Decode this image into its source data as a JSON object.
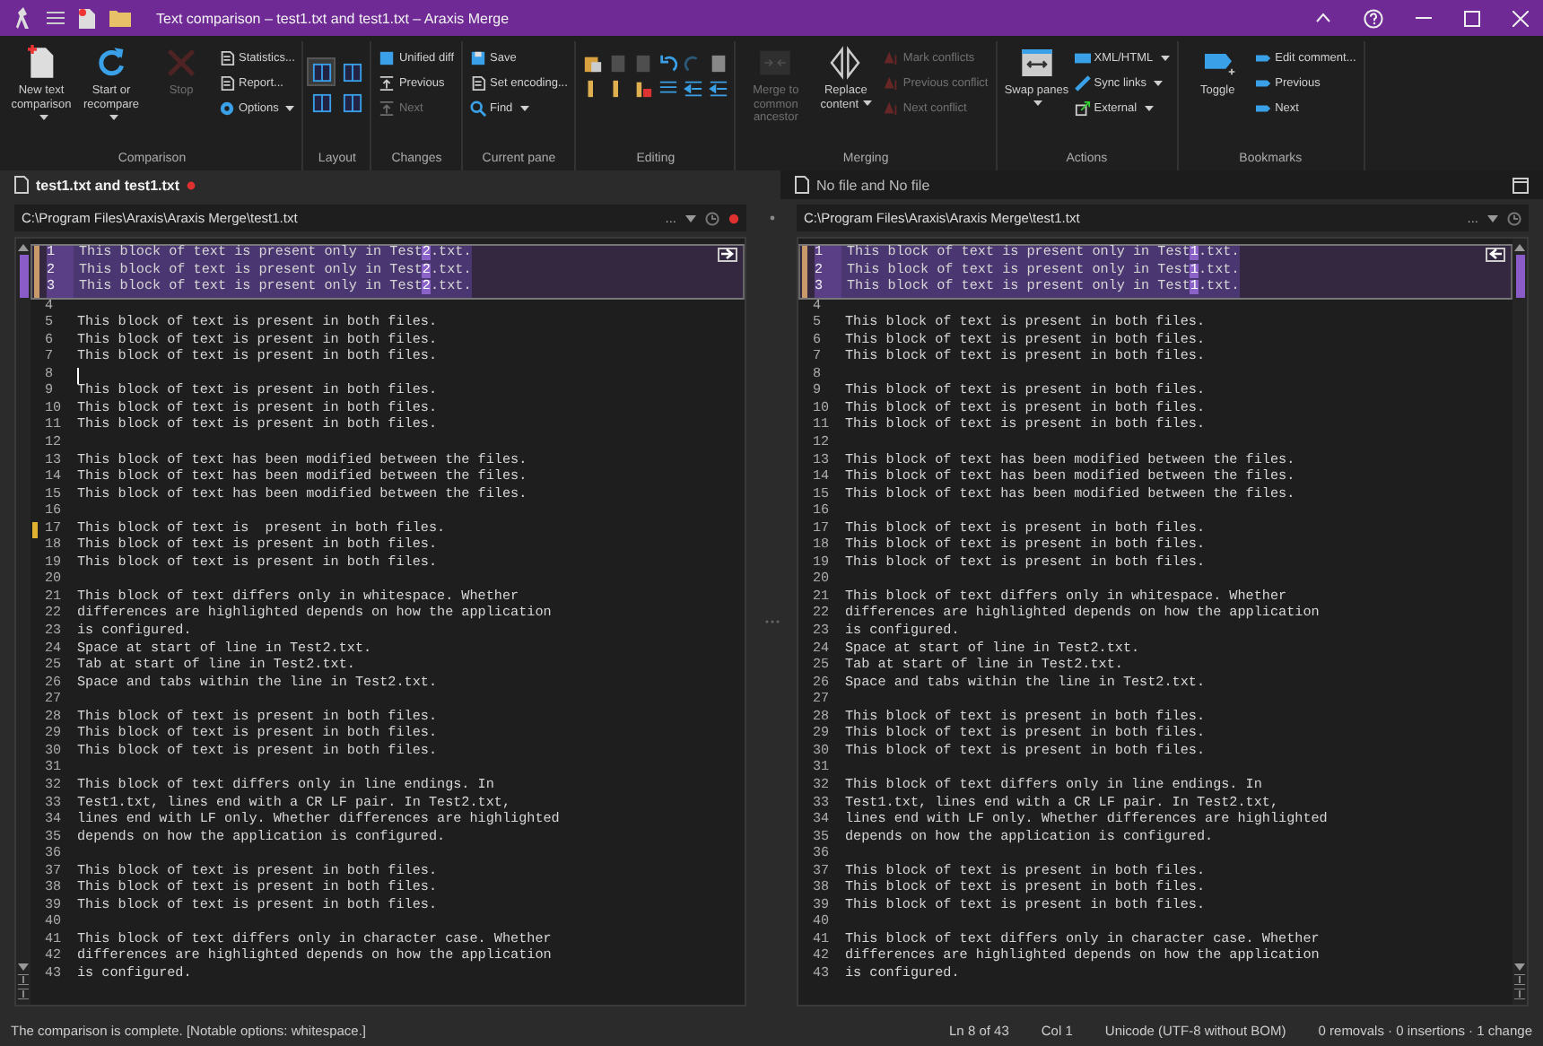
{
  "window": {
    "title": "Text comparison – test1.txt and test1.txt – Araxis Merge"
  },
  "ribbon": [
    {
      "label": "Comparison",
      "items": [
        {
          "kind": "large",
          "label": "New text comparison",
          "dropdown": true,
          "disabled": false
        },
        {
          "kind": "large",
          "label": "Start or recompare",
          "dropdown": true,
          "disabled": false
        },
        {
          "kind": "large",
          "label": "Stop",
          "dropdown": false,
          "disabled": true
        },
        {
          "kind": "small",
          "label": "Statistics...",
          "dropdown": false,
          "disabled": false
        },
        {
          "kind": "small",
          "label": "Report...",
          "dropdown": false,
          "disabled": false
        },
        {
          "kind": "small",
          "label": "Options",
          "dropdown": true,
          "disabled": false
        }
      ]
    },
    {
      "label": "Layout",
      "items": [
        {
          "kind": "icon",
          "disabled": false,
          "selected": true
        },
        {
          "kind": "icon",
          "disabled": false,
          "selected": false
        },
        {
          "kind": "icon",
          "disabled": false,
          "selected": false
        },
        {
          "kind": "icon",
          "disabled": false,
          "selected": false
        }
      ]
    },
    {
      "label": "Changes",
      "items": [
        {
          "kind": "small",
          "label": "Unified diff",
          "dropdown": false,
          "disabled": false
        },
        {
          "kind": "small",
          "label": "Previous",
          "dropdown": false,
          "disabled": false
        },
        {
          "kind": "small",
          "label": "Next",
          "dropdown": false,
          "disabled": true
        }
      ]
    },
    {
      "label": "Current pane",
      "items": [
        {
          "kind": "small",
          "label": "Save",
          "dropdown": false,
          "disabled": false
        },
        {
          "kind": "small",
          "label": "Set encoding...",
          "dropdown": false,
          "disabled": false
        },
        {
          "kind": "small",
          "label": "Find",
          "dropdown": true,
          "disabled": false
        }
      ]
    },
    {
      "label": "Editing",
      "items": [
        {
          "kind": "icon",
          "disabled": false
        },
        {
          "kind": "icon",
          "disabled": true
        },
        {
          "kind": "icon",
          "disabled": true
        },
        {
          "kind": "icon",
          "disabled": false
        },
        {
          "kind": "icon",
          "disabled": true
        },
        {
          "kind": "icon",
          "disabled": false
        },
        {
          "kind": "icon",
          "disabled": false
        },
        {
          "kind": "icon",
          "disabled": false
        },
        {
          "kind": "icon",
          "disabled": false
        },
        {
          "kind": "icon",
          "disabled": false
        },
        {
          "kind": "icon",
          "disabled": false
        },
        {
          "kind": "icon",
          "disabled": false
        }
      ]
    },
    {
      "label": "Merging",
      "items": [
        {
          "kind": "large",
          "label": "Merge to common ancestor",
          "dropdown": false,
          "disabled": true
        },
        {
          "kind": "large",
          "label": "Replace content",
          "dropdown": true,
          "disabled": false
        },
        {
          "kind": "small",
          "label": "Mark conflicts",
          "dropdown": false,
          "disabled": true
        },
        {
          "kind": "small",
          "label": "Previous conflict",
          "dropdown": false,
          "disabled": true
        },
        {
          "kind": "small",
          "label": "Next conflict",
          "dropdown": false,
          "disabled": true
        }
      ]
    },
    {
      "label": "Actions",
      "items": [
        {
          "kind": "large",
          "label": "Swap panes",
          "dropdown": true,
          "disabled": false
        },
        {
          "kind": "small",
          "label": "XML/HTML",
          "dropdown": true,
          "disabled": false
        },
        {
          "kind": "small",
          "label": "Sync links",
          "dropdown": true,
          "disabled": false
        },
        {
          "kind": "small",
          "label": "External",
          "dropdown": true,
          "disabled": false
        }
      ]
    },
    {
      "label": "Bookmarks",
      "items": [
        {
          "kind": "large",
          "label": "Toggle",
          "dropdown": false,
          "disabled": false
        },
        {
          "kind": "small",
          "label": "Edit comment...",
          "dropdown": false,
          "disabled": false
        },
        {
          "kind": "small",
          "label": "Previous",
          "dropdown": false,
          "disabled": false
        },
        {
          "kind": "small",
          "label": "Next",
          "dropdown": false,
          "disabled": false
        }
      ]
    }
  ],
  "tabs": [
    {
      "label": "test1.txt and test1.txt",
      "selected": true,
      "modified": true
    },
    {
      "label": "No file and No file",
      "selected": false,
      "modified": false
    }
  ],
  "panes": [
    {
      "path": "C:\\Program Files\\Araxis\\Araxis Merge\\test1.txt",
      "browse": "...",
      "modified": true,
      "lines": [
        {
          "n": "1",
          "text": "This block of text is present only in Test",
          "hi": "2",
          "tail": ".txt.",
          "changed": true
        },
        {
          "n": "2",
          "text": "This block of text is present only in Test",
          "hi": "2",
          "tail": ".txt.",
          "changed": true
        },
        {
          "n": "3",
          "text": "This block of text is present only in Test",
          "hi": "2",
          "tail": ".txt.",
          "changed": true
        },
        {
          "n": "4"
        },
        {
          "n": "5",
          "text": "This block of text is present in both files."
        },
        {
          "n": "6",
          "text": "This block of text is present in both files."
        },
        {
          "n": "7",
          "text": "This block of text is present in both files."
        },
        {
          "n": "8",
          "cursor": true
        },
        {
          "n": "9",
          "text": "This block of text is present in both files."
        },
        {
          "n": "10",
          "text": "This block of text is present in both files."
        },
        {
          "n": "11",
          "text": "This block of text is present in both files."
        },
        {
          "n": "12"
        },
        {
          "n": "13",
          "text": "This block of text has been modified between the files."
        },
        {
          "n": "14",
          "text": "This block of text has been modified between the files."
        },
        {
          "n": "15",
          "text": "This block of text has been modified between the files."
        },
        {
          "n": "16"
        },
        {
          "n": "17",
          "text": "This block of text is  present in both files.",
          "marked": true
        },
        {
          "n": "18",
          "text": "This block of text is present in both files."
        },
        {
          "n": "19",
          "text": "This block of text is present in both files."
        },
        {
          "n": "20"
        },
        {
          "n": "21",
          "text": "This block of text differs only in whitespace. Whether"
        },
        {
          "n": "22",
          "text": "differences are highlighted depends on how the application"
        },
        {
          "n": "23",
          "text": "is configured."
        },
        {
          "n": "24",
          "text": "Space at start of line in Test2.txt."
        },
        {
          "n": "25",
          "text": "Tab at start of line in Test2.txt."
        },
        {
          "n": "26",
          "text": "Space and tabs within the line in Test2.txt."
        },
        {
          "n": "27"
        },
        {
          "n": "28",
          "text": "This block of text is present in both files."
        },
        {
          "n": "29",
          "text": "This block of text is present in both files."
        },
        {
          "n": "30",
          "text": "This block of text is present in both files."
        },
        {
          "n": "31"
        },
        {
          "n": "32",
          "text": "This block of text differs only in line endings. In"
        },
        {
          "n": "33",
          "text": "Test1.txt, lines end with a CR LF pair. In Test2.txt,"
        },
        {
          "n": "34",
          "text": "lines end with LF only. Whether differences are highlighted"
        },
        {
          "n": "35",
          "text": "depends on how the application is configured."
        },
        {
          "n": "36"
        },
        {
          "n": "37",
          "text": "This block of text is present in both files."
        },
        {
          "n": "38",
          "text": "This block of text is present in both files."
        },
        {
          "n": "39",
          "text": "This block of text is present in both files."
        },
        {
          "n": "40"
        },
        {
          "n": "41",
          "text": "This block of text differs only in character case. Whether"
        },
        {
          "n": "42",
          "text": "differences are highlighted depends on how the application"
        },
        {
          "n": "43",
          "text": "is configured."
        }
      ]
    },
    {
      "path": "C:\\Program Files\\Araxis\\Araxis Merge\\test1.txt",
      "browse": "...",
      "modified": false,
      "lines": [
        {
          "n": "1",
          "text": "This block of text is present only in Test",
          "hi": "1",
          "tail": ".txt.",
          "changed": true
        },
        {
          "n": "2",
          "text": "This block of text is present only in Test",
          "hi": "1",
          "tail": ".txt.",
          "changed": true
        },
        {
          "n": "3",
          "text": "This block of text is present only in Test",
          "hi": "1",
          "tail": ".txt.",
          "changed": true
        },
        {
          "n": "4"
        },
        {
          "n": "5",
          "text": "This block of text is present in both files."
        },
        {
          "n": "6",
          "text": "This block of text is present in both files."
        },
        {
          "n": "7",
          "text": "This block of text is present in both files."
        },
        {
          "n": "8"
        },
        {
          "n": "9",
          "text": "This block of text is present in both files."
        },
        {
          "n": "10",
          "text": "This block of text is present in both files."
        },
        {
          "n": "11",
          "text": "This block of text is present in both files."
        },
        {
          "n": "12"
        },
        {
          "n": "13",
          "text": "This block of text has been modified between the files."
        },
        {
          "n": "14",
          "text": "This block of text has been modified between the files."
        },
        {
          "n": "15",
          "text": "This block of text has been modified between the files."
        },
        {
          "n": "16"
        },
        {
          "n": "17",
          "text": "This block of text is present in both files."
        },
        {
          "n": "18",
          "text": "This block of text is present in both files."
        },
        {
          "n": "19",
          "text": "This block of text is present in both files."
        },
        {
          "n": "20"
        },
        {
          "n": "21",
          "text": "This block of text differs only in whitespace. Whether"
        },
        {
          "n": "22",
          "text": "differences are highlighted depends on how the application"
        },
        {
          "n": "23",
          "text": "is configured."
        },
        {
          "n": "24",
          "text": "Space at start of line in Test2.txt."
        },
        {
          "n": "25",
          "text": "Tab at start of line in Test2.txt."
        },
        {
          "n": "26",
          "text": "Space and tabs within the line in Test2.txt."
        },
        {
          "n": "27"
        },
        {
          "n": "28",
          "text": "This block of text is present in both files."
        },
        {
          "n": "29",
          "text": "This block of text is present in both files."
        },
        {
          "n": "30",
          "text": "This block of text is present in both files."
        },
        {
          "n": "31"
        },
        {
          "n": "32",
          "text": "This block of text differs only in line endings. In"
        },
        {
          "n": "33",
          "text": "Test1.txt, lines end with a CR LF pair. In Test2.txt,"
        },
        {
          "n": "34",
          "text": "lines end with LF only. Whether differences are highlighted"
        },
        {
          "n": "35",
          "text": "depends on how the application is configured."
        },
        {
          "n": "36"
        },
        {
          "n": "37",
          "text": "This block of text is present in both files."
        },
        {
          "n": "38",
          "text": "This block of text is present in both files."
        },
        {
          "n": "39",
          "text": "This block of text is present in both files."
        },
        {
          "n": "40"
        },
        {
          "n": "41",
          "text": "This block of text differs only in character case. Whether"
        },
        {
          "n": "42",
          "text": "differences are highlighted depends on how the application"
        },
        {
          "n": "43",
          "text": "is configured."
        }
      ]
    }
  ],
  "status_bar": {
    "message": "The comparison is complete. [Notable options: whitespace.]",
    "fields": [
      "Ln 8 of 43",
      "Col 1",
      "Unicode (UTF-8 without BOM)",
      "0 removals · 0 insertions · 1 change"
    ]
  }
}
